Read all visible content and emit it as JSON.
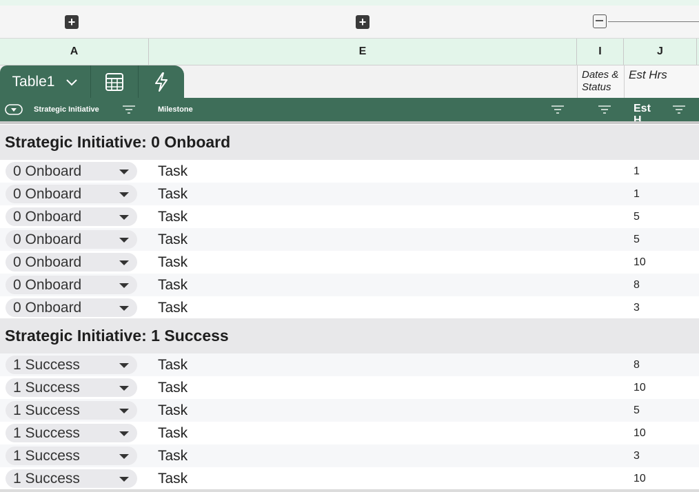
{
  "group_controls": {
    "col_a_toggle": "+",
    "col_e_toggle": "+",
    "col_i_toggle": "−"
  },
  "column_letters": [
    "A",
    "E",
    "I",
    "J"
  ],
  "table_tab": {
    "name": "Table1"
  },
  "meta_headers": {
    "col_i": "Dates & Status",
    "col_j": "Est Hrs"
  },
  "field_headers": {
    "strategic_initiative": "Strategic Initiative",
    "milestone": "Milestone",
    "est_hrs": "Est H"
  },
  "groups": [
    {
      "title": "Strategic Initiative: 0 Onboard",
      "rows": [
        {
          "initiative": "0 Onboard",
          "milestone": "Task",
          "est_hrs": "1"
        },
        {
          "initiative": "0 Onboard",
          "milestone": "Task",
          "est_hrs": "1"
        },
        {
          "initiative": "0 Onboard",
          "milestone": "Task",
          "est_hrs": "5"
        },
        {
          "initiative": "0 Onboard",
          "milestone": "Task",
          "est_hrs": "5"
        },
        {
          "initiative": "0 Onboard",
          "milestone": "Task",
          "est_hrs": "10"
        },
        {
          "initiative": "0 Onboard",
          "milestone": "Task",
          "est_hrs": "8"
        },
        {
          "initiative": "0 Onboard",
          "milestone": "Task",
          "est_hrs": "3"
        }
      ]
    },
    {
      "title": "Strategic Initiative: 1 Success",
      "rows": [
        {
          "initiative": "1 Success",
          "milestone": "Task",
          "est_hrs": "8"
        },
        {
          "initiative": "1 Success",
          "milestone": "Task",
          "est_hrs": "10"
        },
        {
          "initiative": "1 Success",
          "milestone": "Task",
          "est_hrs": "5"
        },
        {
          "initiative": "1 Success",
          "milestone": "Task",
          "est_hrs": "10"
        },
        {
          "initiative": "1 Success",
          "milestone": "Task",
          "est_hrs": "3"
        },
        {
          "initiative": "1 Success",
          "milestone": "Task",
          "est_hrs": "10"
        }
      ]
    }
  ],
  "colors": {
    "header_green": "#3e6e59",
    "column_letter_bg": "#e3f5ea",
    "group_bg": "#e8e8ea"
  },
  "icons": [
    "plus-box-icon",
    "minus-box-icon",
    "chevron-down-icon",
    "calculator-icon",
    "lightning-icon",
    "dropdown-circle-icon",
    "filter-icon",
    "triangle-down-icon"
  ]
}
